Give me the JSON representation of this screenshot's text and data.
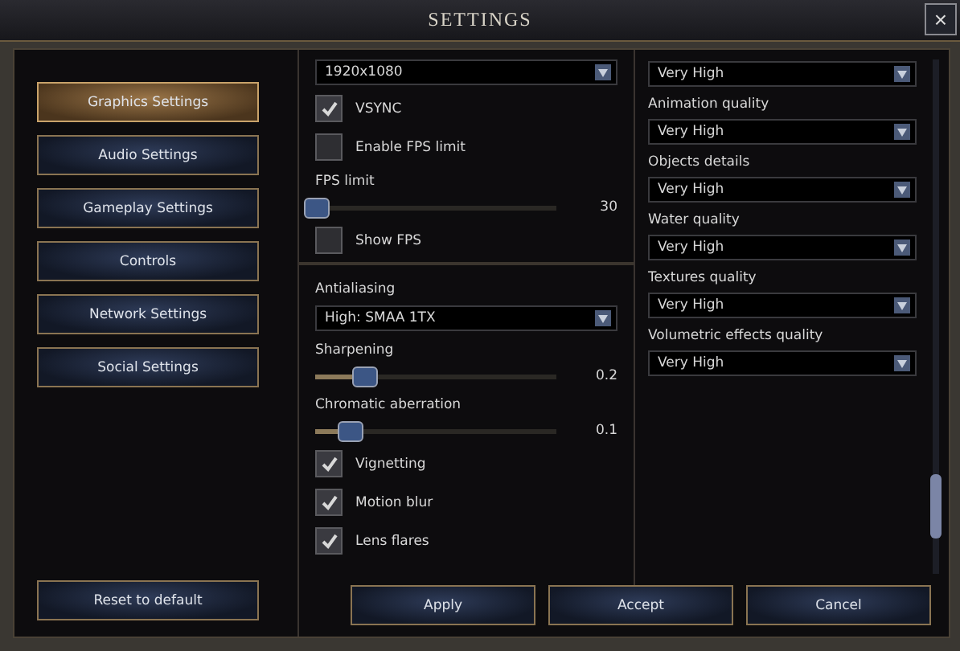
{
  "window": {
    "title": "SETTINGS",
    "close": "×"
  },
  "sidebar": {
    "items": [
      {
        "label": "Graphics Settings",
        "selected": true
      },
      {
        "label": "Audio Settings",
        "selected": false
      },
      {
        "label": "Gameplay Settings",
        "selected": false
      },
      {
        "label": "Controls",
        "selected": false
      },
      {
        "label": "Network Settings",
        "selected": false
      },
      {
        "label": "Social Settings",
        "selected": false
      }
    ],
    "reset": "Reset to default"
  },
  "groups": [
    {
      "items": [
        {
          "kind": "dropdown",
          "value": "1920x1080"
        },
        {
          "kind": "checkbox",
          "label": "VSYNC",
          "checked": true
        },
        {
          "kind": "checkbox",
          "label": "Enable FPS limit",
          "checked": false
        },
        {
          "kind": "slider",
          "label": "FPS limit",
          "level": 0,
          "reading": "30"
        },
        {
          "kind": "checkbox",
          "label": "Show FPS",
          "checked": false
        }
      ]
    },
    {
      "items": [
        {
          "kind": "dropdown",
          "label": "Antialiasing",
          "value": "High: SMAA 1TX"
        },
        {
          "kind": "slider",
          "label": "Sharpening",
          "level": 0.2,
          "reading": "0.2"
        },
        {
          "kind": "slider",
          "label": "Chromatic aberration",
          "level": 0.14,
          "reading": "0.1"
        },
        {
          "kind": "checkbox",
          "label": "Vignetting",
          "checked": true
        },
        {
          "kind": "checkbox",
          "label": "Motion blur",
          "checked": true
        },
        {
          "kind": "checkbox",
          "label": "Lens flares",
          "checked": true
        }
      ]
    }
  ],
  "quality": [
    {
      "value": "Very High"
    },
    {
      "label": "Animation quality",
      "value": "Very High"
    },
    {
      "label": "Objects details",
      "value": "Very High"
    },
    {
      "label": "Water quality",
      "value": "Very High"
    },
    {
      "label": "Textures quality",
      "value": "Very High"
    },
    {
      "label": "Volumetric effects quality",
      "value": "Very High"
    }
  ],
  "buttons": [
    "Apply",
    "Accept",
    "Cancel"
  ]
}
